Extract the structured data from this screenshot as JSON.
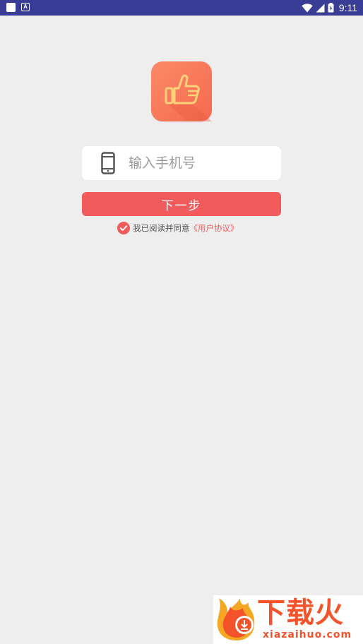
{
  "status_bar": {
    "time": "9:11",
    "icons": [
      "notification-square-icon",
      "app-a-icon",
      "wifi-icon",
      "signal-icon",
      "battery-icon"
    ],
    "app_icon_letter": "A"
  },
  "logo": {
    "icon": "thumbs-up-icon"
  },
  "phone_field": {
    "icon": "phone-icon",
    "placeholder": "输入手机号",
    "value": ""
  },
  "next_button": {
    "label": "下一步"
  },
  "agreement": {
    "checked": true,
    "text": "我已阅读并同意",
    "link": "《用户协议》"
  },
  "watermark": {
    "title": "下载火",
    "url": "xiazaihuo.com"
  },
  "colors": {
    "status_bar": "#3a3d96",
    "background": "#efeeef",
    "accent": "#f25b5b",
    "logo": "#f5694f",
    "watermark": "#f2532a"
  }
}
